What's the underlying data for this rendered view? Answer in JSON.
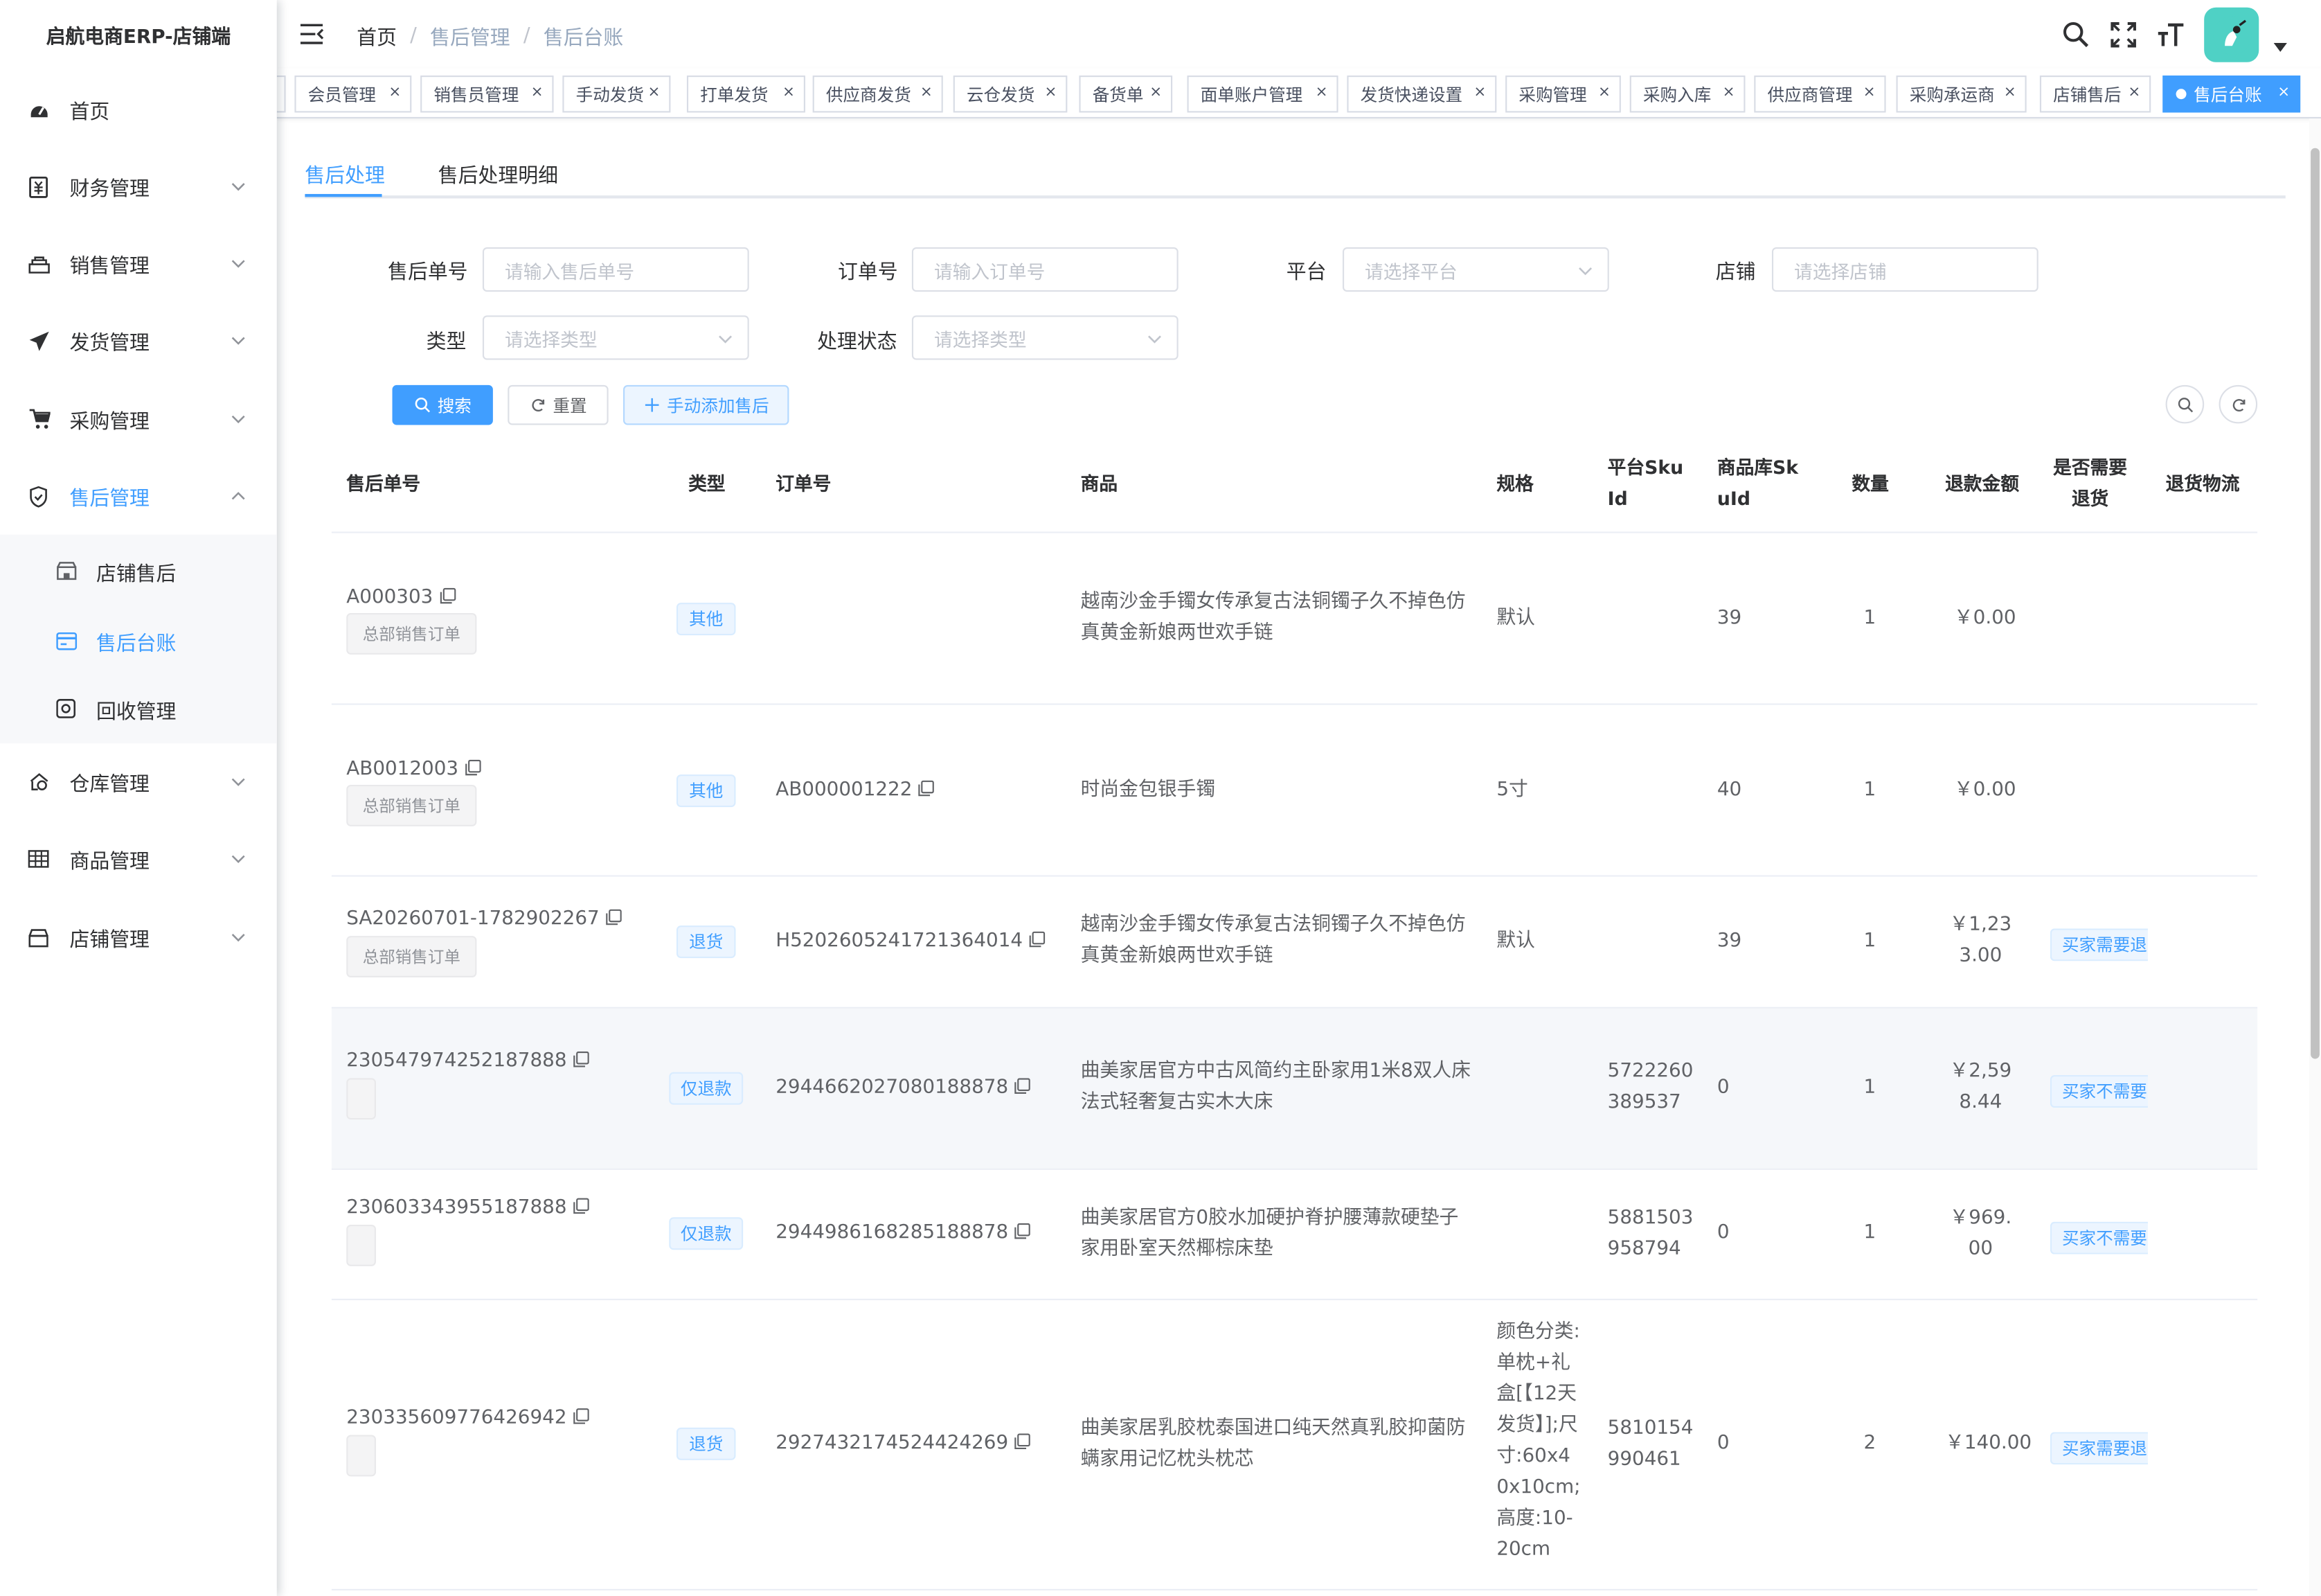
{
  "app": {
    "title": "启航电商ERP-店铺端"
  },
  "sidebar": {
    "items": [
      {
        "label": "首页",
        "icon": "dashboard-icon"
      },
      {
        "label": "财务管理",
        "icon": "finance-icon"
      },
      {
        "label": "销售管理",
        "icon": "sales-icon"
      },
      {
        "label": "发货管理",
        "icon": "send-icon"
      },
      {
        "label": "采购管理",
        "icon": "cart-icon"
      },
      {
        "label": "售后管理",
        "icon": "shield-icon"
      },
      {
        "label": "仓库管理",
        "icon": "warehouse-icon"
      },
      {
        "label": "商品管理",
        "icon": "table-icon"
      },
      {
        "label": "店铺管理",
        "icon": "shop-icon"
      }
    ],
    "subitems": [
      {
        "label": "店铺售后",
        "icon": "store-icon"
      },
      {
        "label": "售后台账",
        "icon": "card-icon"
      },
      {
        "label": "回收管理",
        "icon": "recycle-icon"
      }
    ]
  },
  "breadcrumb": [
    "首页",
    "售后管理",
    "售后台账"
  ],
  "tags": [
    "会员管理",
    "销售员管理",
    "手动发货",
    "打单发货",
    "供应商发货",
    "云仓发货",
    "备货单",
    "面单账户管理",
    "发货快递设置",
    "采购管理",
    "采购入库",
    "供应商管理",
    "采购承运商",
    "店铺售后",
    "售后台账"
  ],
  "tabs": [
    "售后处理",
    "售后处理明细"
  ],
  "filters": {
    "after_sale_no": {
      "label": "售后单号",
      "placeholder": "请输入售后单号"
    },
    "order_no": {
      "label": "订单号",
      "placeholder": "请输入订单号"
    },
    "platform": {
      "label": "平台",
      "placeholder": "请选择平台"
    },
    "shop": {
      "label": "店铺",
      "placeholder": "请选择店铺"
    },
    "type": {
      "label": "类型",
      "placeholder": "请选择类型"
    },
    "status": {
      "label": "处理状态",
      "placeholder": "请选择类型"
    }
  },
  "buttons": {
    "search": "搜索",
    "reset": "重置",
    "add": "手动添加售后"
  },
  "table": {
    "headers": {
      "no": "售后单号",
      "type": "类型",
      "order": "订单号",
      "goods": "商品",
      "spec": "规格",
      "platform_sku": "平台SkuId",
      "goods_sku": "商品库SkuId",
      "qty": "数量",
      "amount": "退款金额",
      "need_return": "是否需要退货",
      "logistics": "退货物流"
    },
    "rows": [
      {
        "no": "A000303",
        "source": "总部销售订单",
        "type": "其他",
        "order": "",
        "goods": "越南沙金手镯女传承复古法铜镯子久不掉色仿真黄金新娘两世欢手链",
        "spec": "默认",
        "platform_sku": "",
        "goods_sku": "39",
        "qty": "1",
        "amount": "￥0.00",
        "need_return": ""
      },
      {
        "no": "AB0012003",
        "source": "总部销售订单",
        "type": "其他",
        "order": "AB000001222",
        "goods": "时尚金包银手镯",
        "spec": "5寸",
        "platform_sku": "",
        "goods_sku": "40",
        "qty": "1",
        "amount": "￥0.00",
        "need_return": ""
      },
      {
        "no": "SA20260701-1782902267",
        "source": "总部销售订单",
        "type": "退货",
        "order": "H5202605241721364014",
        "goods": "越南沙金手镯女传承复古法铜镯子久不掉色仿真黄金新娘两世欢手链",
        "spec": "默认",
        "platform_sku": "",
        "goods_sku": "39",
        "qty": "1",
        "amount": "￥1,233.00",
        "need_return": "买家需要退货"
      },
      {
        "no": "230547974252187888",
        "source": "",
        "type": "仅退款",
        "order": "2944662027080188878",
        "goods": "曲美家居官方中古风简约主卧家用1米8双人床法式轻奢复古实木大床",
        "spec": "",
        "platform_sku": "5722260389537",
        "goods_sku": "0",
        "qty": "1",
        "amount": "￥2,598.44",
        "need_return": "买家不需要退货"
      },
      {
        "no": "230603343955187888",
        "source": "",
        "type": "仅退款",
        "order": "2944986168285188878",
        "goods": "曲美家居官方0胶水加硬护脊护腰薄款硬垫子家用卧室天然椰棕床垫",
        "spec": "",
        "platform_sku": "5881503958794",
        "goods_sku": "0",
        "qty": "1",
        "amount": "￥969.00",
        "need_return": "买家不需要退货"
      },
      {
        "no": "230335609776426942",
        "source": "",
        "type": "退货",
        "order": "2927432174524424269",
        "goods": "曲美家居乳胶枕泰国进口纯天然真乳胶抑菌防螨家用记忆枕头枕芯",
        "spec": "颜色分类:单枕+礼盒[【12天发货】];尺寸:60x40x10cm;高度:10-20cm",
        "platform_sku": "5810154990461",
        "goods_sku": "0",
        "qty": "2",
        "amount": "￥140.00",
        "need_return": "买家需要退货"
      }
    ]
  },
  "colors": {
    "primary": "#409eff",
    "text": "#303133",
    "muted": "#606266",
    "avatar_bg": "#4fd1c5"
  }
}
